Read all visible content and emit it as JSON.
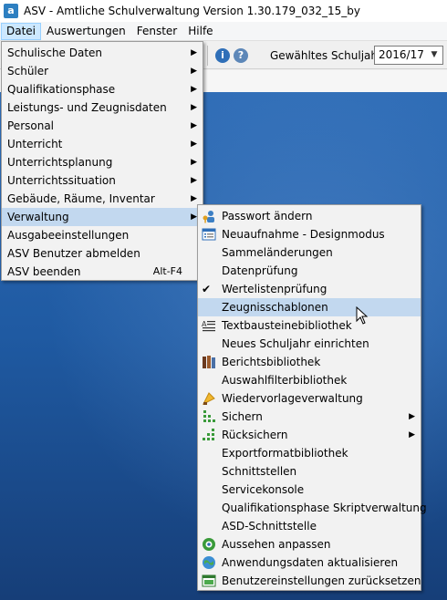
{
  "window": {
    "title": "ASV - Amtliche Schulverwaltung Version 1.30.179_032_15_by",
    "app_icon": "a"
  },
  "menubar": {
    "items": [
      {
        "label": "Datei",
        "open": true
      },
      {
        "label": "Auswertungen"
      },
      {
        "label": "Fenster"
      },
      {
        "label": "Hilfe"
      }
    ]
  },
  "toolbar": {
    "info_glyph": "i",
    "help_glyph": "?",
    "year_label": "Gewähltes Schuljahr",
    "year_value": "2016/17",
    "dropdown_arrow": "▼"
  },
  "main_menu": {
    "items": [
      {
        "label": "Schulische Daten",
        "submenu": true
      },
      {
        "label": "Schüler",
        "submenu": true
      },
      {
        "label": "Qualifikationsphase",
        "submenu": true
      },
      {
        "label": "Leistungs- und Zeugnisdaten",
        "submenu": true
      },
      {
        "label": "Personal",
        "submenu": true
      },
      {
        "label": "Unterricht",
        "submenu": true
      },
      {
        "label": "Unterrichtsplanung",
        "submenu": true
      },
      {
        "label": "Unterrichtssituation",
        "submenu": true
      },
      {
        "label": "Gebäude, Räume, Inventar",
        "submenu": true
      },
      {
        "label": "Verwaltung",
        "submenu": true,
        "highlighted": true
      },
      {
        "label": "Ausgabeeinstellungen"
      },
      {
        "label": "ASV Benutzer abmelden"
      },
      {
        "label": "ASV beenden",
        "shortcut": "Alt-F4"
      }
    ]
  },
  "sub_menu": {
    "items": [
      {
        "label": "Passwort ändern",
        "icon": "key-user-icon"
      },
      {
        "label": "Neuaufnahme - Designmodus",
        "icon": "form-icon"
      },
      {
        "label": "Sammeländerungen"
      },
      {
        "label": "Datenprüfung"
      },
      {
        "label": "Wertelistenprüfung",
        "checked": true,
        "check_glyph": "✔"
      },
      {
        "label": "Zeugnisschablonen",
        "highlighted": true
      },
      {
        "label": "Textbausteinebibliothek",
        "icon": "text-lines-icon"
      },
      {
        "label": "Neues Schuljahr einrichten"
      },
      {
        "label": "Berichtsbibliothek",
        "icon": "books-icon"
      },
      {
        "label": "Auswahlfilterbibliothek"
      },
      {
        "label": "Wiedervorlageverwaltung",
        "icon": "flag-icon"
      },
      {
        "label": "Sichern",
        "icon": "backup-icon",
        "submenu": true
      },
      {
        "label": "Rücksichern",
        "icon": "restore-icon",
        "submenu": true
      },
      {
        "label": "Exportformatbibliothek"
      },
      {
        "label": "Schnittstellen"
      },
      {
        "label": "Servicekonsole"
      },
      {
        "label": "Qualifikationsphase Skriptverwaltung"
      },
      {
        "label": "ASD-Schnittstelle"
      },
      {
        "label": "Aussehen anpassen",
        "icon": "appearance-icon"
      },
      {
        "label": "Anwendungsdaten aktualisieren",
        "icon": "refresh-globe-icon"
      },
      {
        "label": "Benutzereinstellungen zurücksetzen",
        "icon": "reset-window-icon"
      }
    ]
  },
  "submenu_arrow": "▶",
  "colors": {
    "highlight": "#c2d8ef",
    "menubar_open": "#cce8ff",
    "desktop_blue": "#1f5aa2"
  }
}
